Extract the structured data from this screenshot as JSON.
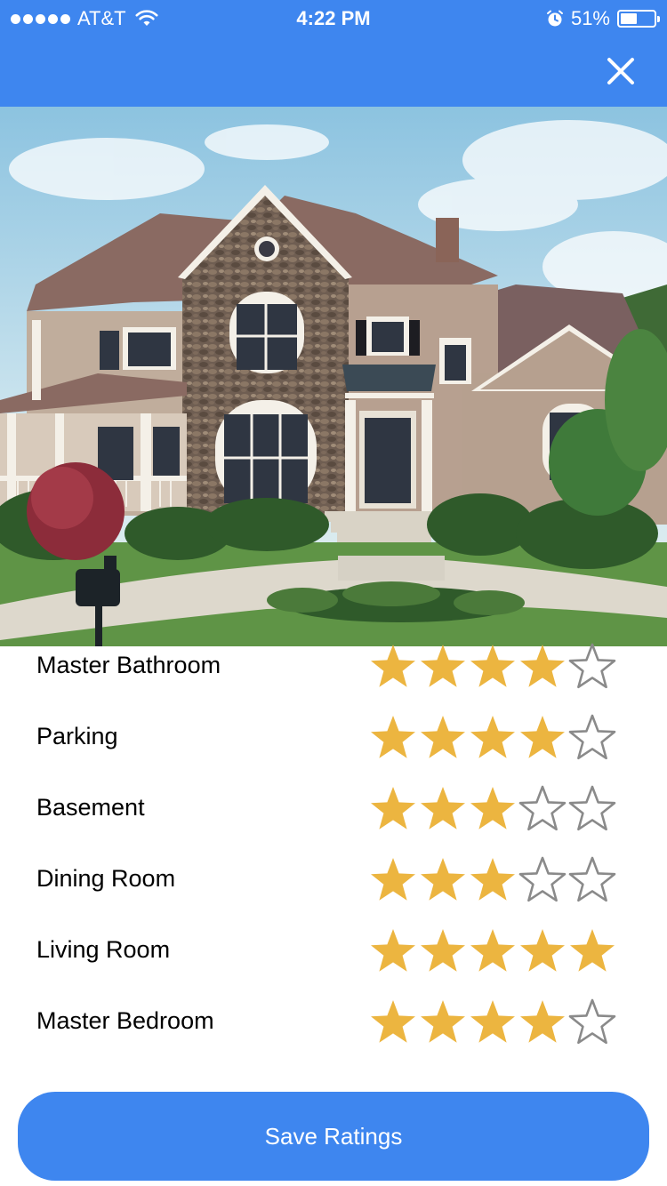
{
  "status_bar": {
    "carrier": "AT&T",
    "time": "4:22 PM",
    "battery": "51%",
    "battery_level": 0.51,
    "signal_bars": 5,
    "icons": [
      "signal-dots-icon",
      "wifi-icon",
      "alarm-icon",
      "battery-icon"
    ]
  },
  "header": {
    "background_color": "#3e86ef",
    "close_icon": "close-icon"
  },
  "hero": {
    "subject": "house-photo"
  },
  "ratings": {
    "max_stars": 5,
    "filled_color": "#ecb540",
    "empty_color": "#8a8a8a",
    "items": [
      {
        "label": "Master Bathroom",
        "stars": 4
      },
      {
        "label": "Parking",
        "stars": 4
      },
      {
        "label": "Basement",
        "stars": 3
      },
      {
        "label": "Dining Room",
        "stars": 3
      },
      {
        "label": "Living Room",
        "stars": 5
      },
      {
        "label": "Master Bedroom",
        "stars": 4
      }
    ]
  },
  "footer": {
    "save_label": "Save Ratings",
    "button_color": "#3e86ef"
  }
}
